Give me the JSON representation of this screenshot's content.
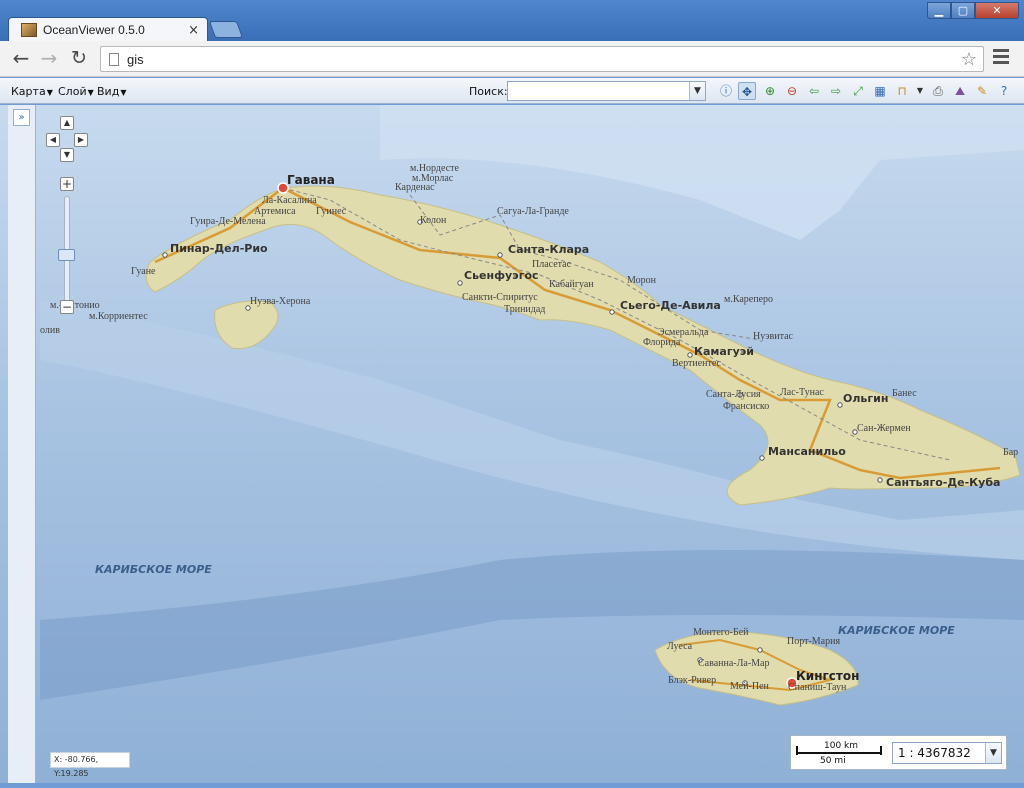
{
  "window": {
    "tab_title": "OceanViewer 0.5.0",
    "minimize_glyph": "▁",
    "maximize_glyph": "▢",
    "close_glyph": "✕"
  },
  "address": {
    "url": "gis"
  },
  "toolbar": {
    "menus": [
      {
        "label": "Карта"
      },
      {
        "label": "Слой"
      },
      {
        "label": "Вид"
      }
    ],
    "search_label": "Поиск:",
    "search_value": "",
    "tools": [
      {
        "icon": "info-icon"
      },
      {
        "icon": "pan-icon",
        "active": true
      },
      {
        "icon": "zoom-in-icon"
      },
      {
        "icon": "zoom-out-icon"
      },
      {
        "icon": "back-arrow-icon"
      },
      {
        "icon": "forward-arrow-icon"
      },
      {
        "icon": "full-extent-icon"
      },
      {
        "icon": "table-icon"
      },
      {
        "icon": "measure-icon"
      },
      {
        "icon": "print-icon"
      },
      {
        "icon": "chart-icon"
      },
      {
        "icon": "edit-icon"
      },
      {
        "icon": "help-icon"
      }
    ]
  },
  "map": {
    "colors": {
      "sea_deep": "#8fb0d6",
      "sea_light": "#c7daee",
      "land": "#e3dcaa",
      "road": "#d89b35"
    },
    "cities_big": [
      {
        "name": "Гавана"
      },
      {
        "name": "Кингстон"
      }
    ],
    "cities_mid": [
      {
        "name": "Пинар-Дел-Рио"
      },
      {
        "name": "Санта-Клара"
      },
      {
        "name": "Сьенфуэгос"
      },
      {
        "name": "Сьего-Де-Авила"
      },
      {
        "name": "Камагуэй"
      },
      {
        "name": "Ольгин"
      },
      {
        "name": "Мансанильо"
      },
      {
        "name": "Сантьяго-Де-Куба"
      }
    ],
    "cities_small": [
      {
        "name": "м.Нордесте"
      },
      {
        "name": "м.Морлас"
      },
      {
        "name": "Карденас"
      },
      {
        "name": "Ла-Касалина"
      },
      {
        "name": "Артемиса"
      },
      {
        "name": "Гуинес"
      },
      {
        "name": "Гуира-Де-Мелена"
      },
      {
        "name": "Колон"
      },
      {
        "name": "Сагуа-Ла-Гранде"
      },
      {
        "name": "Пласетас"
      },
      {
        "name": "Гуане"
      },
      {
        "name": "Нуэва-Херона"
      },
      {
        "name": "м.-Антонио"
      },
      {
        "name": "м.Корриентес"
      },
      {
        "name": "Морон"
      },
      {
        "name": "Кабайгуан"
      },
      {
        "name": "Санкти-Спиритус"
      },
      {
        "name": "Тринидад"
      },
      {
        "name": "м.Кареперо"
      },
      {
        "name": "Нуэвитас"
      },
      {
        "name": "Эсмеральда"
      },
      {
        "name": "Флорида"
      },
      {
        "name": "Вертиентес"
      },
      {
        "name": "Санта-Лусия"
      },
      {
        "name": "Франсиско"
      },
      {
        "name": "Лас-Тунас"
      },
      {
        "name": "Банес"
      },
      {
        "name": "Сан-Жермен"
      },
      {
        "name": "Бар"
      },
      {
        "name": "Монтего-Бей"
      },
      {
        "name": "Луеса"
      },
      {
        "name": "Порт-Мария"
      },
      {
        "name": "Саванна-Ла-Мар"
      },
      {
        "name": "Блэк-Ривер"
      },
      {
        "name": "Мей-Пен"
      },
      {
        "name": "Спаниш-Таун"
      },
      {
        "name": "олив"
      }
    ],
    "seas": [
      {
        "name": "КАРИБСКОЕ МОРЕ"
      },
      {
        "name": "КАРИБСКОЕ МОРЕ"
      }
    ],
    "coords_text": "X: -80.766, Y:19.285",
    "scale_km": "100 km",
    "scale_mi": "50 mi",
    "scale_value": "1 : 4367832"
  }
}
